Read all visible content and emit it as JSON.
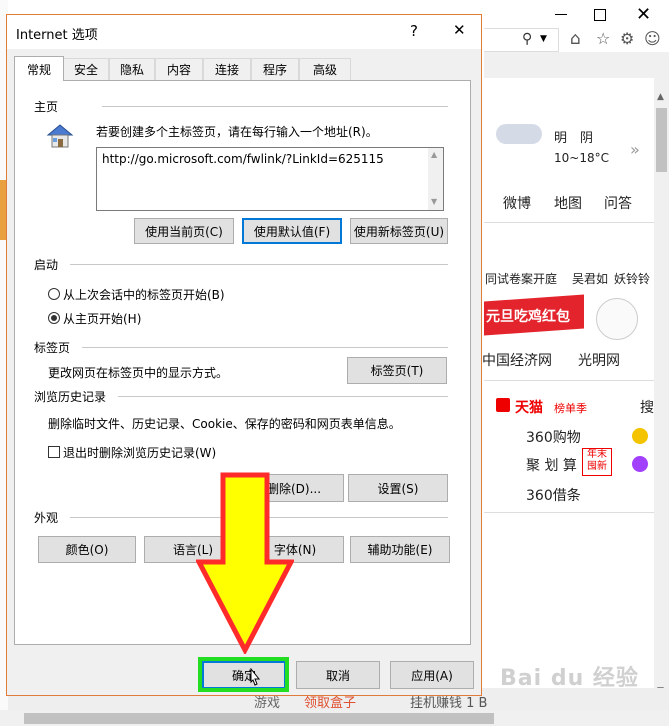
{
  "browser": {
    "weather_condition": "明　阴",
    "weather_temp": "10~18°C",
    "nav_links": [
      "微博",
      "地图",
      "问答"
    ],
    "news_snippet_1": "同试卷案开庭",
    "news_snippet_2": "吴君如",
    "news_snippet_3": "妖铃铃",
    "banner_text": "元旦吃鸡红包",
    "site_links": [
      "中国经济网",
      "光明网"
    ],
    "tmall_name": "天猫",
    "tmall_tag": "榜单季",
    "search_partial": "搜",
    "list_items": [
      "360购物",
      "聚 划 算",
      "360借条"
    ],
    "badge_text": "年末\n囤新",
    "bottom_text_1": "游戏",
    "bottom_text_2": "领取盒子",
    "bottom_text_3": "挂机赚钱 1 B"
  },
  "dialog": {
    "title": "Internet 选项",
    "help_label": "?",
    "close_label": "✕",
    "tabs": [
      "常规",
      "安全",
      "隐私",
      "内容",
      "连接",
      "程序",
      "高级"
    ],
    "homepage": {
      "heading": "主页",
      "instruction": "若要创建多个主标签页，请在每行输入一个地址(R)。",
      "url": "http://go.microsoft.com/fwlink/?LinkId=625115",
      "btn_current": "使用当前页(C)",
      "btn_default": "使用默认值(F)",
      "btn_newtab": "使用新标签页(U)"
    },
    "startup": {
      "heading": "启动",
      "option_last": "从上次会话中的标签页开始(B)",
      "option_home": "从主页开始(H)"
    },
    "tabs_section": {
      "heading": "标签页",
      "description": "更改网页在标签页中的显示方式。",
      "btn": "标签页(T)"
    },
    "history": {
      "heading": "浏览历史记录",
      "description": "删除临时文件、历史记录、Cookie、保存的密码和网页表单信息。",
      "checkbox": "退出时删除浏览历史记录(W)",
      "btn_delete": "删除(D)...",
      "btn_settings": "设置(S)"
    },
    "appearance": {
      "heading": "外观",
      "btn_colors": "颜色(O)",
      "btn_languages": "语言(L)",
      "btn_fonts": "字体(N)",
      "btn_accessibility": "辅助功能(E)"
    },
    "footer": {
      "ok": "确定",
      "cancel": "取消",
      "apply": "应用(A)"
    }
  },
  "watermark": "Bai du 经验",
  "colors": {
    "arrow_fill": "#ffff00",
    "arrow_stroke": "#ff2a2a",
    "highlight": "#22dd22",
    "dialog_border": "#e07b39"
  }
}
